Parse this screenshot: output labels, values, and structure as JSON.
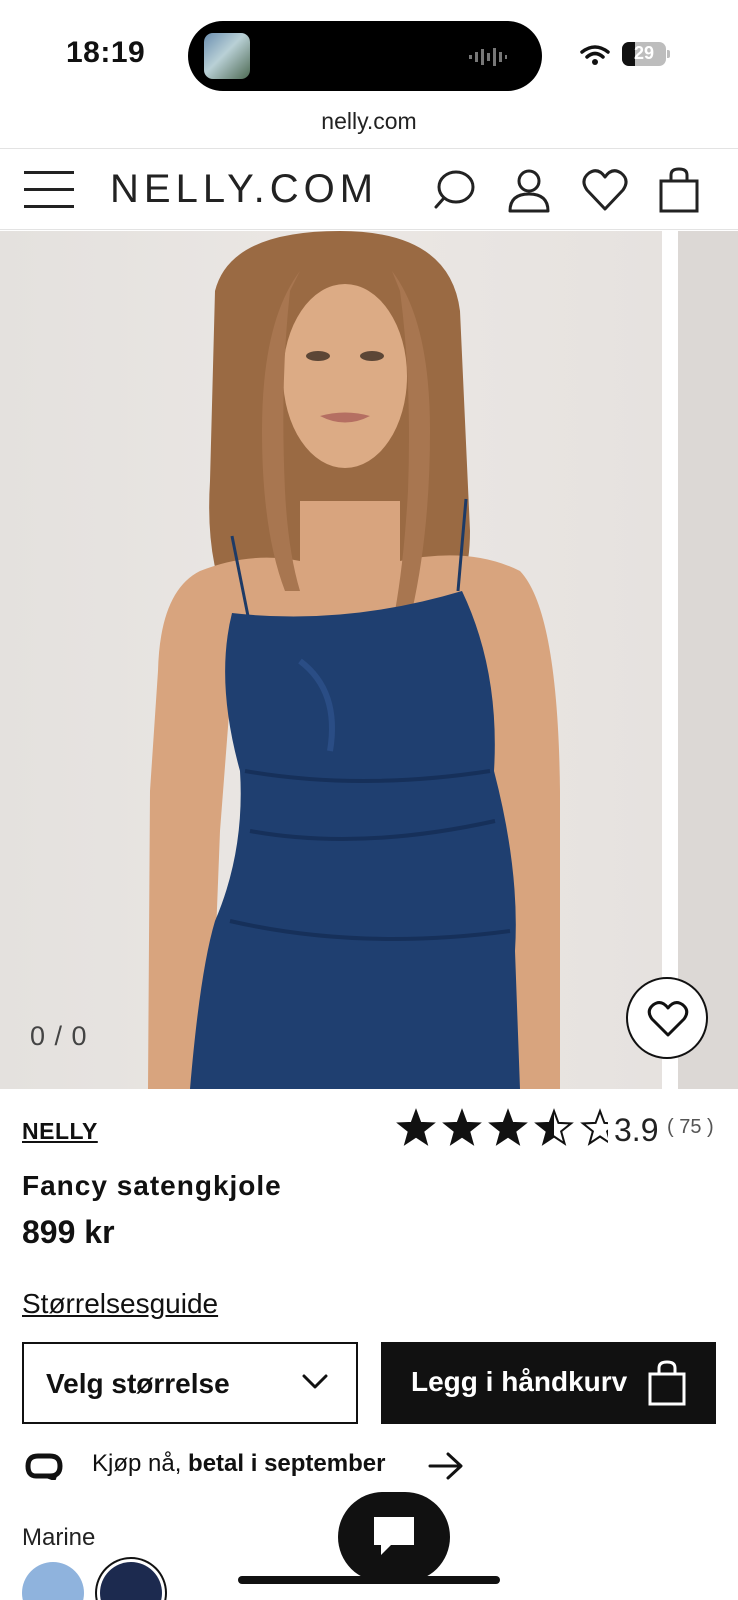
{
  "status_bar": {
    "time": "18:19",
    "battery": "29",
    "battery_level": 0.29
  },
  "browser": {
    "url": "nelly.com"
  },
  "header": {
    "logo": "NELLY.COM",
    "icons": [
      "menu-icon",
      "search-icon",
      "account-icon",
      "heart-icon",
      "bag-icon"
    ]
  },
  "gallery": {
    "counter": "0 / 0"
  },
  "product": {
    "brand": "NELLY",
    "rating": {
      "value": "3.9",
      "count": "( 75 )",
      "stars": 3.5
    },
    "name": "Fancy satengkjole",
    "price": "899 kr",
    "size_guide": "Størrelsesguide",
    "size_select_label": "Velg størrelse",
    "add_to_cart_label": "Legg i håndkurv",
    "klarna_prefix": "Kjøp nå, ",
    "klarna_bold": "betal i september",
    "color_label": "Marine",
    "swatch_colors": [
      "#8fb3dd",
      "#1c2a4f"
    ]
  },
  "colors": {
    "text": "#111111",
    "button_bg": "#111111",
    "button_text": "#ffffff"
  }
}
